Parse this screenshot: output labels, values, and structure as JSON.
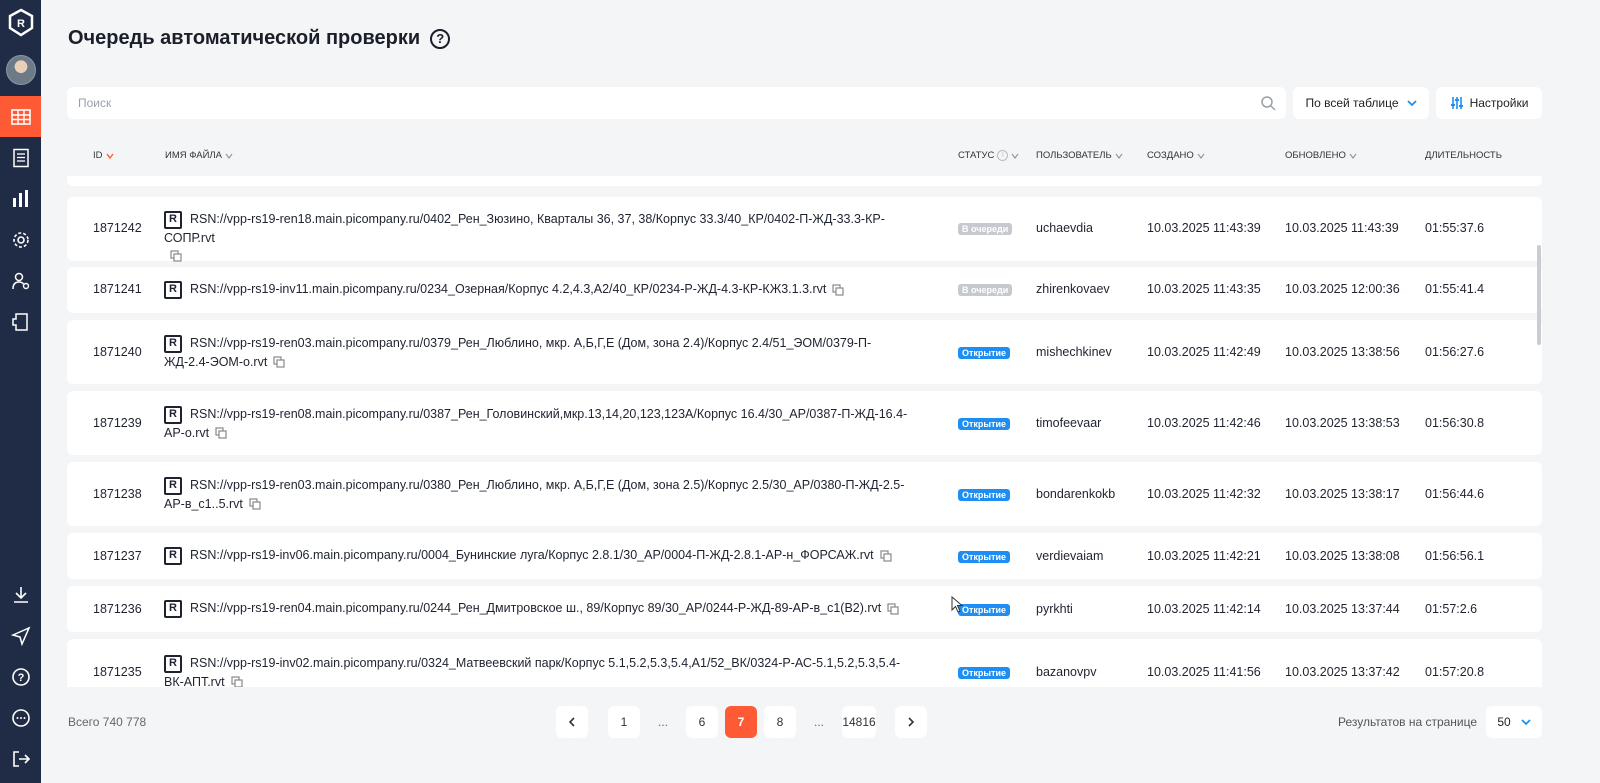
{
  "page": {
    "title": "Очередь автоматической проверки",
    "help_glyph": "?"
  },
  "toolbar": {
    "search_placeholder": "Поиск",
    "scope_label": "По всей таблице",
    "settings_label": "Настройки"
  },
  "columns": {
    "id": "ID",
    "file": "Имя файла",
    "status": "Статус",
    "user": "Пользователь",
    "created": "Создано",
    "updated": "Обновлено",
    "duration": "Длительность"
  },
  "rows": [
    {
      "id": "1871242",
      "file": "RSN://vpp-rs19-ren18.main.picompany.ru/0402_Рен_Зюзино, Кварталы 36, 37, 38/Корпус 33.3/40_КР/0402-П-ЖД-33.3-КР-СОПР.rvt",
      "status": "В очереди",
      "status_kind": "queue",
      "user": "uchaevdia",
      "created": "10.03.2025 11:43:39",
      "updated": "10.03.2025 11:43:39",
      "duration": "01:55:37.6"
    },
    {
      "id": "1871241",
      "file": "RSN://vpp-rs19-inv11.main.picompany.ru/0234_Озерная/Корпус 4.2,4.3,А2/40_КР/0234-Р-ЖД-4.3-КР-КЖ3.1.3.rvt",
      "status": "В очереди",
      "status_kind": "queue",
      "user": "zhirenkovaev",
      "created": "10.03.2025 11:43:35",
      "updated": "10.03.2025 12:00:36",
      "duration": "01:55:41.4"
    },
    {
      "id": "1871240",
      "file": "RSN://vpp-rs19-ren03.main.picompany.ru/0379_Рен_Люблино, мкр. А,Б,Г,Е (Дом, зона 2.4)/Корпус 2.4/51_ЭОМ/0379-П-ЖД-2.4-ЭОМ-о.rvt",
      "status": "Открытие",
      "status_kind": "open",
      "user": "mishechkinev",
      "created": "10.03.2025 11:42:49",
      "updated": "10.03.2025 13:38:56",
      "duration": "01:56:27.6"
    },
    {
      "id": "1871239",
      "file": "RSN://vpp-rs19-ren08.main.picompany.ru/0387_Рен_Головинский,мкр.13,14,20,123,123А/Корпус 16.4/30_АР/0387-П-ЖД-16.4-АР-о.rvt",
      "status": "Открытие",
      "status_kind": "open",
      "user": "timofeevaar",
      "created": "10.03.2025 11:42:46",
      "updated": "10.03.2025 13:38:53",
      "duration": "01:56:30.8"
    },
    {
      "id": "1871238",
      "file": "RSN://vpp-rs19-ren03.main.picompany.ru/0380_Рен_Люблино, мкр. А,Б,Г,Е (Дом, зона 2.5)/Корпус 2.5/30_АР/0380-П-ЖД-2.5-АР-в_с1..5.rvt",
      "status": "Открытие",
      "status_kind": "open",
      "user": "bondarenkokb",
      "created": "10.03.2025 11:42:32",
      "updated": "10.03.2025 13:38:17",
      "duration": "01:56:44.6"
    },
    {
      "id": "1871237",
      "file": "RSN://vpp-rs19-inv06.main.picompany.ru/0004_Бунинские луга/Корпус 2.8.1/30_АР/0004-П-ЖД-2.8.1-АР-н_ФОРСАЖ.rvt",
      "status": "Открытие",
      "status_kind": "open",
      "user": "verdievaiam",
      "created": "10.03.2025 11:42:21",
      "updated": "10.03.2025 13:38:08",
      "duration": "01:56:56.1"
    },
    {
      "id": "1871236",
      "file": "RSN://vpp-rs19-ren04.main.picompany.ru/0244_Рен_Дмитровское ш., 89/Корпус 89/30_АР/0244-Р-ЖД-89-АР-в_с1(В2).rvt",
      "status": "Открытие",
      "status_kind": "open",
      "user": "pyrkhti",
      "created": "10.03.2025 11:42:14",
      "updated": "10.03.2025 13:37:44",
      "duration": "01:57:2.6"
    },
    {
      "id": "1871235",
      "file": "RSN://vpp-rs19-inv02.main.picompany.ru/0324_Матвеевский парк/Корпус 5.1,5.2,5.3,5.4,А1/52_ВК/0324-Р-АС-5.1,5.2,5.3,5.4-ВК-АПТ.rvt",
      "status": "Открытие",
      "status_kind": "open",
      "user": "bazanovpv",
      "created": "10.03.2025 11:41:56",
      "updated": "10.03.2025 13:37:42",
      "duration": "01:57:20.8"
    }
  ],
  "footer": {
    "total": "Всего 740 778",
    "pages": [
      "1",
      "...",
      "6",
      "7",
      "8",
      "...",
      "14816"
    ],
    "current_page": "7",
    "per_page_label": "Результатов на странице",
    "per_page_value": "50"
  },
  "icons": {
    "logo": "r-logo-icon",
    "file": "r-file-icon",
    "accent": "#ff5a36",
    "sidebar_bg": "#202c45",
    "status_open": "#1e8ef2",
    "status_queue": "#c6c9ce"
  }
}
